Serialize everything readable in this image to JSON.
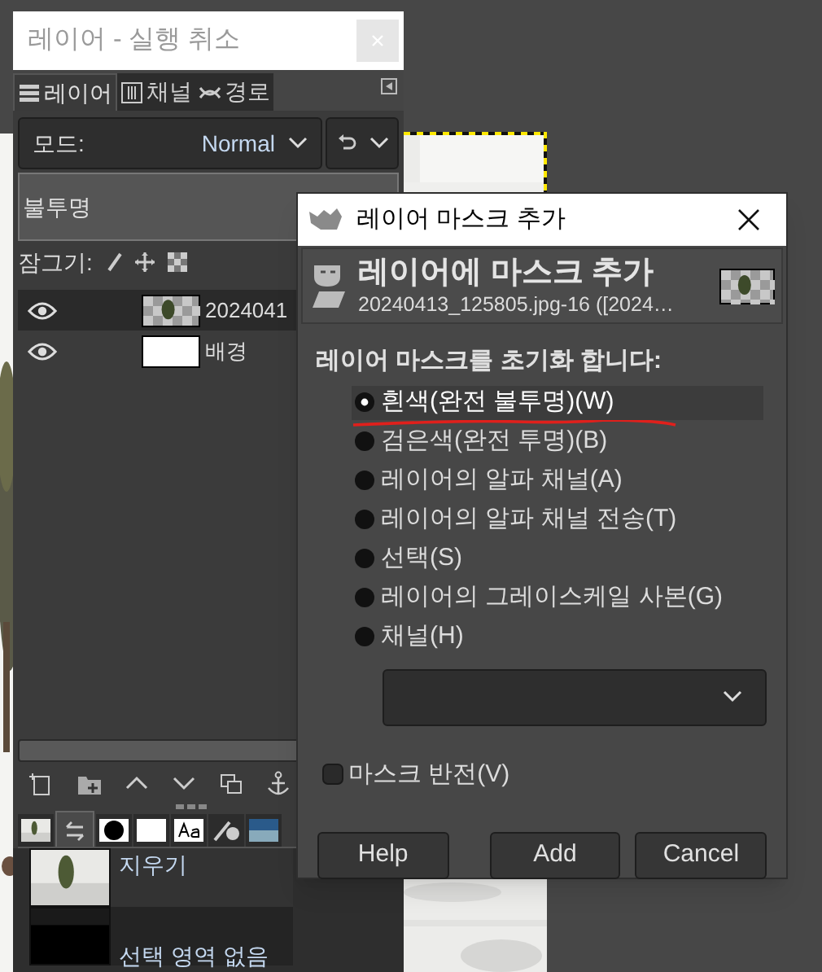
{
  "layers_dock": {
    "title": "레이어 - 실행 취소",
    "tabs": [
      {
        "label": "레이어",
        "selected": true
      },
      {
        "label": "채널",
        "selected": false
      },
      {
        "label": "경로",
        "selected": false
      }
    ],
    "mode": {
      "label": "모드:",
      "value": "Normal"
    },
    "opacity": {
      "label": "불투명"
    },
    "lock": {
      "label": "잠그기:"
    },
    "layers": [
      {
        "name": "2024041",
        "visible": true,
        "selected": true
      },
      {
        "name": "배경",
        "visible": true,
        "selected": false,
        "kind": "white"
      }
    ],
    "undo_history": [
      {
        "label": "지우기",
        "selected": false
      },
      {
        "label": "선택 영역 없음",
        "selected": true,
        "kind": "black"
      }
    ]
  },
  "dialog": {
    "title": "레이어 마스크 추가",
    "heading": "레이어에 마스크 추가",
    "subtitle": "20240413_125805.jpg-16 ([2024…",
    "section_label": "레이어 마스크를 초기화 합니다:",
    "options": [
      {
        "label": "흰색(완전 불투명)(W)",
        "selected": true
      },
      {
        "label": "검은색(완전 투명)(B)",
        "selected": false
      },
      {
        "label": "레이어의 알파 채널(A)",
        "selected": false
      },
      {
        "label": "레이어의 알파 채널 전송(T)",
        "selected": false
      },
      {
        "label": "선택(S)",
        "selected": false
      },
      {
        "label": "레이어의 그레이스케일 사본(G)",
        "selected": false
      },
      {
        "label": "채널(H)",
        "selected": false
      }
    ],
    "invert": {
      "label": "마스크 반전(V)",
      "checked": false
    },
    "buttons": [
      "Help",
      "Add",
      "Cancel"
    ]
  }
}
